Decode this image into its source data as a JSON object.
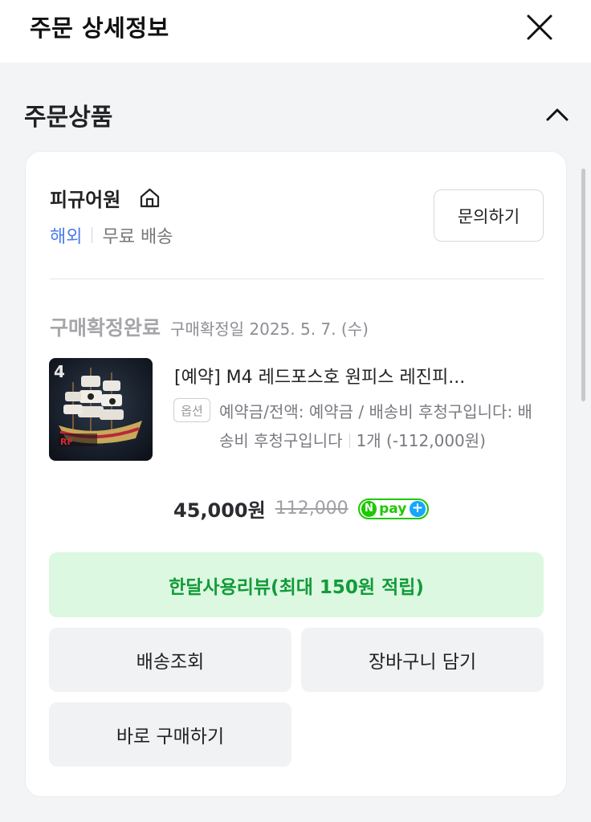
{
  "header": {
    "title": "주문 상세정보",
    "close_icon": "close-icon"
  },
  "section": {
    "title": "주문상품",
    "collapse_icon": "chevron-up-icon"
  },
  "seller": {
    "name": "피규어원",
    "home_icon": "home-icon",
    "overseas": "해외",
    "shipping": "무료 배송",
    "inquiry_label": "문의하기"
  },
  "order": {
    "status": "구매확정완료",
    "confirm_date": "구매확정일 2025. 5. 7. (수)"
  },
  "product": {
    "title": "[예약] M4 레드포스호 원피스 레진피...",
    "option_badge": "옵션",
    "option_text": "예약금/전액: 예약금 / 배송비 후청구입니다: 배송비 후청구입니다",
    "quantity_text": "1개 (-112,000원)",
    "price": "45,000원",
    "original_price": "112,000",
    "npay_n": "N",
    "npay_text": "pay",
    "npay_plus": "+"
  },
  "buttons": {
    "review": "한달사용리뷰(최대 150원 적립)",
    "track": "배송조회",
    "cart": "장바구니 담기",
    "buy_again": "바로 구매하기"
  },
  "colors": {
    "accent_blue": "#4b7bec",
    "review_bg": "#dcf8e1",
    "review_text": "#129b3a",
    "npay_green": "#1ec800"
  }
}
